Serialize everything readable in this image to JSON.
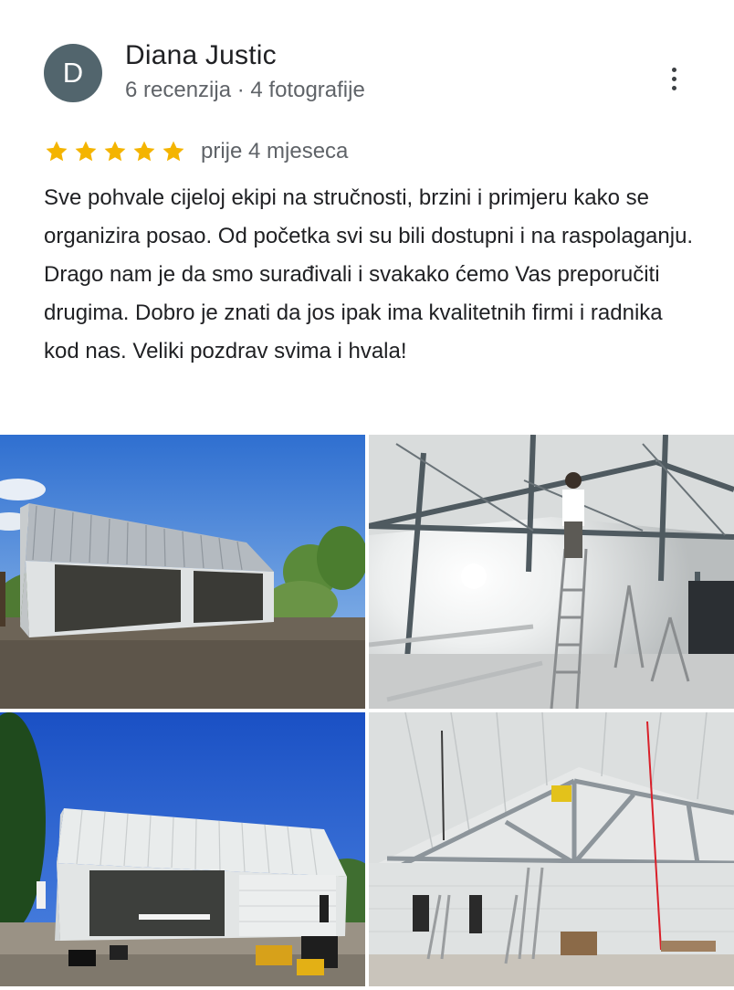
{
  "review": {
    "avatar_initial": "D",
    "author": "Diana Justic",
    "meta": "6 recenzija · 4 fotografije",
    "rating": 5,
    "max_rating": 5,
    "date": "prije 4 mjeseca",
    "text": "Sve pohvale cijeloj ekipi na stručnosti, brzini i primjeru kako se organizira posao. Od početka svi su bili dostupni i na raspolaganju. Drago nam je da smo surađivali i svakako ćemo Vas preporučiti drugima. Dobro je znati da jos ipak ima kvalitetnih firmi i radnika kod nas. Veliki pozdrav svima i hvala!",
    "more_icon": "more-vert-icon",
    "star_icon": "star-icon"
  },
  "colors": {
    "avatar_bg": "#52656d",
    "star": "#f4b400",
    "text_primary": "#202124",
    "text_secondary": "#5f6368"
  }
}
